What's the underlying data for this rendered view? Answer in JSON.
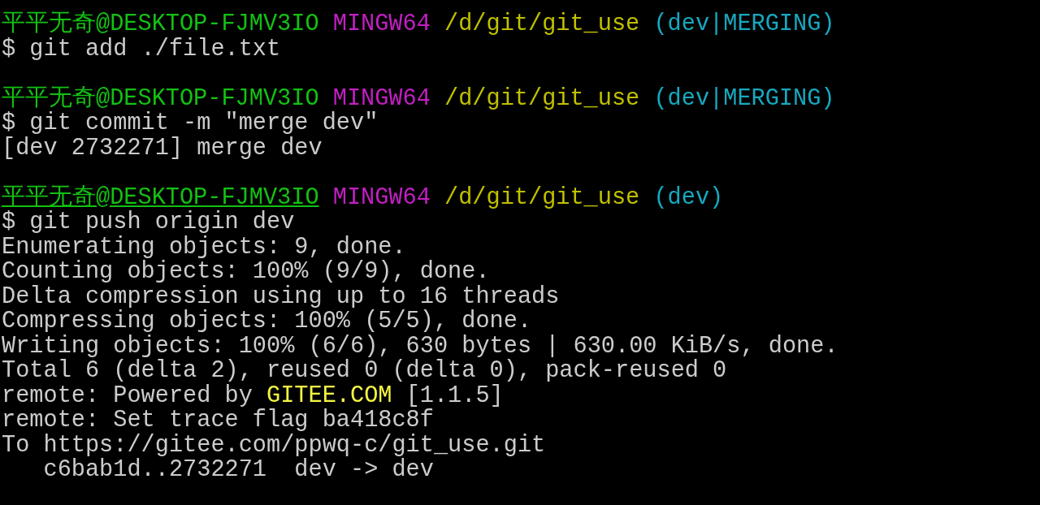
{
  "terminal": {
    "lines": [
      {
        "kind": "prompt",
        "user_host": "平平无奇@DESKTOP-FJMV3IO",
        "shell": "MINGW64",
        "path": "/d/git/git_use",
        "branch": "(dev|MERGING)",
        "underlined": false
      },
      {
        "kind": "command",
        "text": "$ git add ./file.txt"
      },
      {
        "kind": "blank"
      },
      {
        "kind": "prompt",
        "user_host": "平平无奇@DESKTOP-FJMV3IO",
        "shell": "MINGW64",
        "path": "/d/git/git_use",
        "branch": "(dev|MERGING)",
        "underlined": false
      },
      {
        "kind": "command",
        "text": "$ git commit -m \"merge dev\""
      },
      {
        "kind": "output",
        "segments": [
          {
            "text": "[dev 2732271] merge dev",
            "highlight": false
          }
        ]
      },
      {
        "kind": "blank"
      },
      {
        "kind": "prompt",
        "user_host": "平平无奇@DESKTOP-FJMV3IO",
        "shell": "MINGW64",
        "path": "/d/git/git_use",
        "branch": "(dev)",
        "underlined": true
      },
      {
        "kind": "command",
        "text": "$ git push origin dev"
      },
      {
        "kind": "output",
        "segments": [
          {
            "text": "Enumerating objects: 9, done.",
            "highlight": false
          }
        ]
      },
      {
        "kind": "output",
        "segments": [
          {
            "text": "Counting objects: 100% (9/9), done.",
            "highlight": false
          }
        ]
      },
      {
        "kind": "output",
        "segments": [
          {
            "text": "Delta compression using up to 16 threads",
            "highlight": false
          }
        ]
      },
      {
        "kind": "output",
        "segments": [
          {
            "text": "Compressing objects: 100% (5/5), done.",
            "highlight": false
          }
        ]
      },
      {
        "kind": "output",
        "segments": [
          {
            "text": "Writing objects: 100% (6/6), 630 bytes | 630.00 KiB/s, done.",
            "highlight": false
          }
        ]
      },
      {
        "kind": "output",
        "segments": [
          {
            "text": "Total 6 (delta 2), reused 0 (delta 0), pack-reused 0",
            "highlight": false
          }
        ]
      },
      {
        "kind": "output",
        "segments": [
          {
            "text": "remote: Powered by ",
            "highlight": false
          },
          {
            "text": "GITEE.COM",
            "highlight": true
          },
          {
            "text": " [1.1.5]",
            "highlight": false
          }
        ]
      },
      {
        "kind": "output",
        "segments": [
          {
            "text": "remote: Set trace flag ba418c8f",
            "highlight": false
          }
        ]
      },
      {
        "kind": "output",
        "segments": [
          {
            "text": "To https://gitee.com/ppwq-c/git_use.git",
            "highlight": false
          }
        ]
      },
      {
        "kind": "output",
        "segments": [
          {
            "text": "   c6bab1d..2732271  dev -> dev",
            "highlight": false
          }
        ]
      }
    ]
  }
}
